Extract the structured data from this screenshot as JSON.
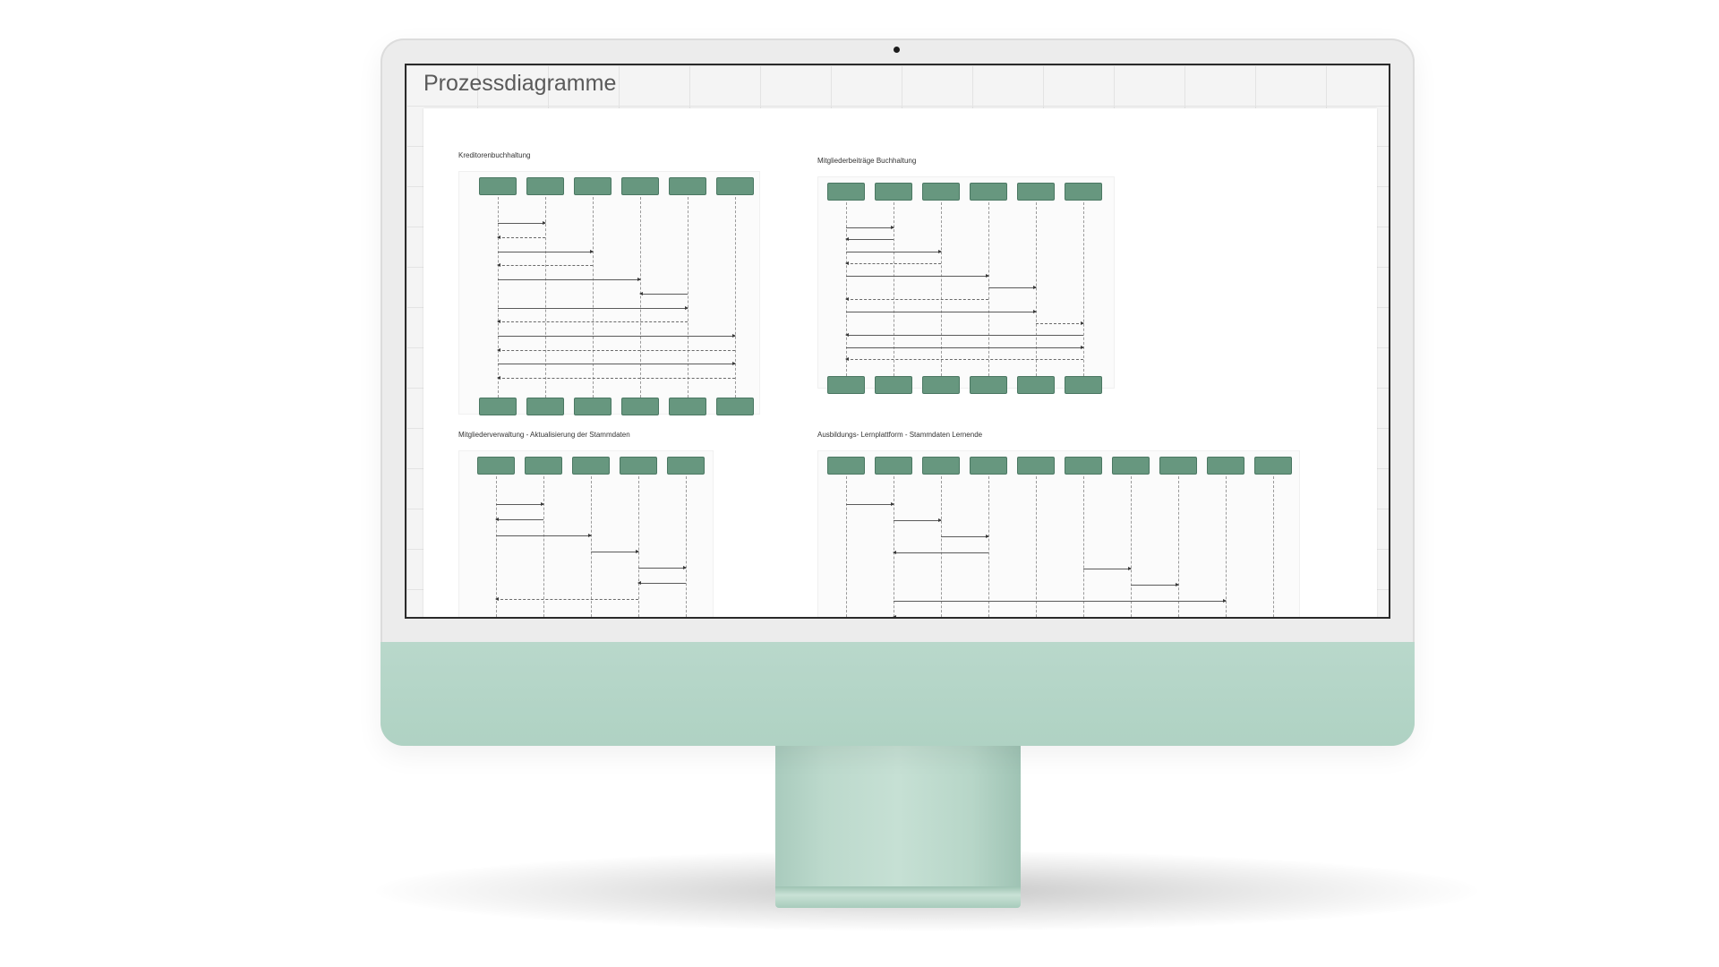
{
  "page": {
    "title": "Prozessdiagramme"
  },
  "diagrams": [
    {
      "title": "Kreditorenbuchhaltung"
    },
    {
      "title": "Mitgliederbeiträge Buchhaltung"
    },
    {
      "title": "Mitgliederverwaltung - Aktualisierung der Stammdaten"
    },
    {
      "title": "Ausbildungs- Lernplattform - Stammdaten Lernende"
    }
  ],
  "colors": {
    "actor_fill": "#67977f",
    "chin": "#b4d5c7",
    "stand": "#bcd9cc"
  }
}
